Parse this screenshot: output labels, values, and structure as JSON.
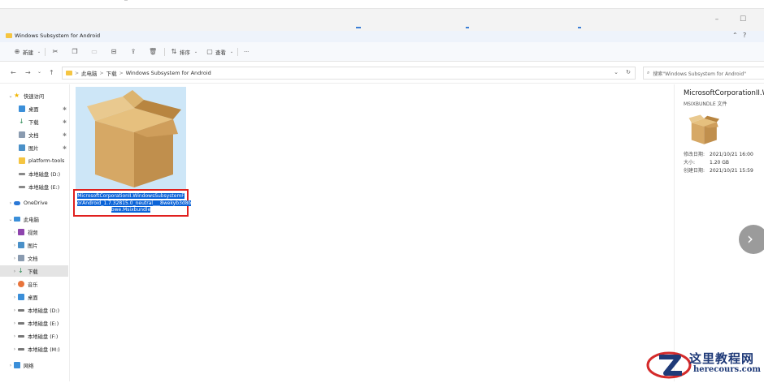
{
  "window": {
    "title": "Windows Subsystem for Android",
    "minimize_glyph": "–",
    "maximize_glyph": "☐",
    "help_glyph": "?"
  },
  "commandbar": {
    "new_label": "新建",
    "sort_label": "排序",
    "view_label": "查看",
    "more_label": "···"
  },
  "navigation": {
    "back": "←",
    "forward": "→",
    "recent": "⌄",
    "up": "↑"
  },
  "address": {
    "crumbs": [
      "此电脑",
      "下载",
      "Windows Subsystem for Android"
    ],
    "separator": ">"
  },
  "search": {
    "placeholder": "搜索\"Windows Subsystem for Android\""
  },
  "sidebar": {
    "quick_access": "快速访问",
    "quick_items": [
      "桌面",
      "下载",
      "文档",
      "图片",
      "platform-tools",
      "本地磁盘 (D:)",
      "本地磁盘 (E:)"
    ],
    "onedrive": "OneDrive",
    "this_pc": "此电脑",
    "pc_items": [
      "视频",
      "图片",
      "文档",
      "下载",
      "音乐",
      "桌面",
      "本地磁盘 (D:)",
      "本地磁盘 (E:)",
      "本地磁盘 (F:)",
      "本地磁盘 (M:)"
    ],
    "network": "网络",
    "pin_glyph": "📌"
  },
  "file": {
    "name_lines": [
      "MicrosoftCorporationII.WindowsSubsystemF",
      "orAndroid_1.7.32815.0_neutral___8wekyb3d8b",
      "bwe.Msixbundle"
    ]
  },
  "details": {
    "name": "MicrosoftCorporationII.Wi",
    "type": "MSIXBUNDLE 文件",
    "modified_label": "修改日期:",
    "modified_value": "2021/10/21 16:00",
    "size_label": "大小:",
    "size_value": "1.20 GB",
    "created_label": "创建日期:",
    "created_value": "2021/10/21 15:59"
  },
  "next_glyph": "›",
  "watermark": {
    "cn": "这里教程网",
    "en": "herecours.com"
  },
  "colors": {
    "selection_blue": "#0a63d8",
    "highlight_red": "#e0201e",
    "tile_blue": "#cde6f7",
    "box_brown": "#d6a865"
  }
}
